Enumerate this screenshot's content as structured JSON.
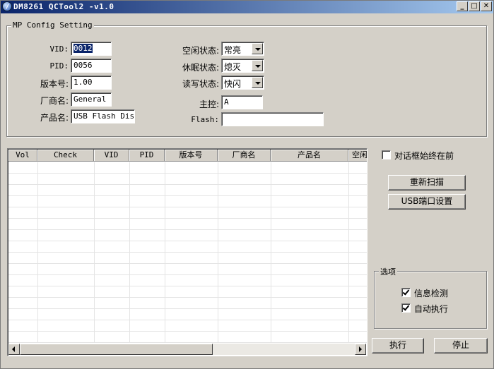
{
  "window": {
    "title": "DM8261 QCTool2 -v1.0",
    "min": "_",
    "max": "□",
    "close": "✕"
  },
  "config": {
    "title": "MP Config Setting",
    "vid_label": "VID:",
    "vid_value": "0012",
    "pid_label": "PID:",
    "pid_value": "0056",
    "version_label": "版本号:",
    "version_value": "1.00",
    "vendor_label": "厂商名:",
    "vendor_value": "General",
    "product_label": "产品名:",
    "product_value": "USB Flash Disk",
    "idle_label": "空闲状态:",
    "idle_value": "常亮",
    "sleep_label": "休眠状态:",
    "sleep_value": "熄灭",
    "rw_label": "读写状态:",
    "rw_value": "快闪",
    "controller_label": "主控:",
    "controller_value": "A",
    "flash_label": "Flash:",
    "flash_value": ""
  },
  "table": {
    "columns": [
      "Vol",
      "Check",
      "VID",
      "PID",
      "版本号",
      "厂商名",
      "产品名",
      "空闲"
    ]
  },
  "side": {
    "topmost_label": "对话框始终在前",
    "rescan_button": "重新扫描",
    "usb_port_button": "USB端口设置",
    "options_title": "选项",
    "info_check_label": "信息检测",
    "auto_exec_label": "自动执行",
    "execute_button": "执行",
    "stop_button": "停止"
  }
}
